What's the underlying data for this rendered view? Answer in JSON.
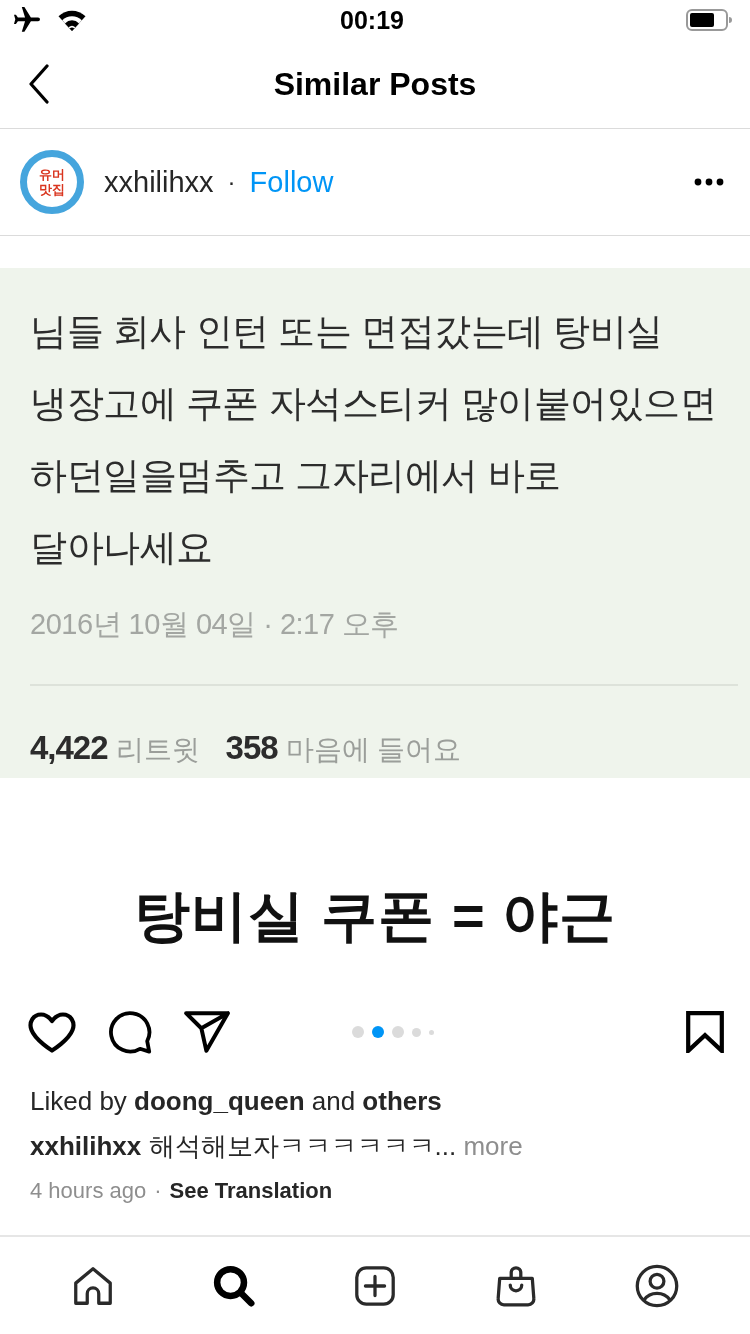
{
  "status_bar": {
    "time": "00:19"
  },
  "nav": {
    "title": "Similar Posts"
  },
  "post": {
    "author": {
      "avatar_text": "유머\n맛집",
      "username": "xxhilihxx",
      "separator": "·",
      "follow": "Follow"
    },
    "image": {
      "tweet": {
        "text": "님들 회사 인턴 또는 면접갔는데 탕비실\n냉장고에 쿠폰 자석스티커 많이붙어있으면\n하던일을멈추고 그자리에서 바로\n달아나세요",
        "date": "2016년 10월 04일 · 2:17 오후",
        "stats": [
          {
            "count": "4,422",
            "label": "리트윗"
          },
          {
            "count": "358",
            "label": "마음에 들어요"
          }
        ]
      },
      "caption": "탕비실 쿠폰 = 야근"
    },
    "carousel_dots": [
      {
        "kind": "full",
        "selected": false
      },
      {
        "kind": "full",
        "selected": true
      },
      {
        "kind": "full",
        "selected": false
      },
      {
        "kind": "medium",
        "selected": false
      },
      {
        "kind": "small",
        "selected": false
      }
    ],
    "likes": "Liked by **doong_queen** and **others**",
    "caption": {
      "text": "**xxhilihxx** 해석해보자ㅋㅋㅋㅋㅋㅋ...",
      "more": "more"
    },
    "time": "4 hours ago",
    "time_separator": "·",
    "translate": "See Translation"
  },
  "tab_bar": [
    {
      "selected": false
    },
    {
      "selected": true
    },
    {
      "selected": false
    },
    {
      "selected": false
    },
    {
      "selected": false
    }
  ]
}
